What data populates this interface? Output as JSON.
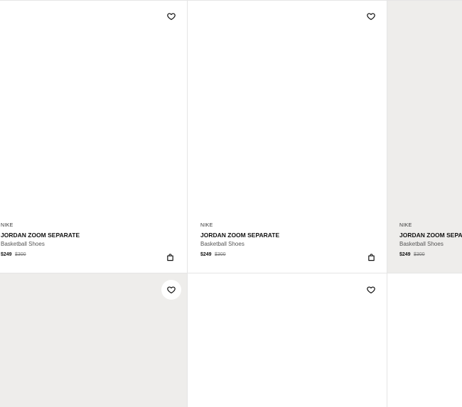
{
  "products": [
    {
      "brand": "NIKE",
      "name": "JORDAN ZOOM SEPARATE",
      "category": "Basketball Shoes",
      "price": "$249",
      "original_price": "$300"
    },
    {
      "brand": "NIKE",
      "name": "JORDAN ZOOM SEPARATE",
      "category": "Basketball Shoes",
      "price": "$249",
      "original_price": "$300"
    },
    {
      "brand": "NIKE",
      "name": "JORDAN ZOOM SEPARATE",
      "category": "Basketball Shoes",
      "price": "$249",
      "original_price": "$300"
    }
  ],
  "icons": {
    "favorite": "heart-icon",
    "cart": "shopping-bag-icon"
  },
  "colors": {
    "card_gray_bg": "#eeedeb",
    "divider": "#e5e5e5",
    "text": "#111111",
    "muted_text": "#555555"
  }
}
